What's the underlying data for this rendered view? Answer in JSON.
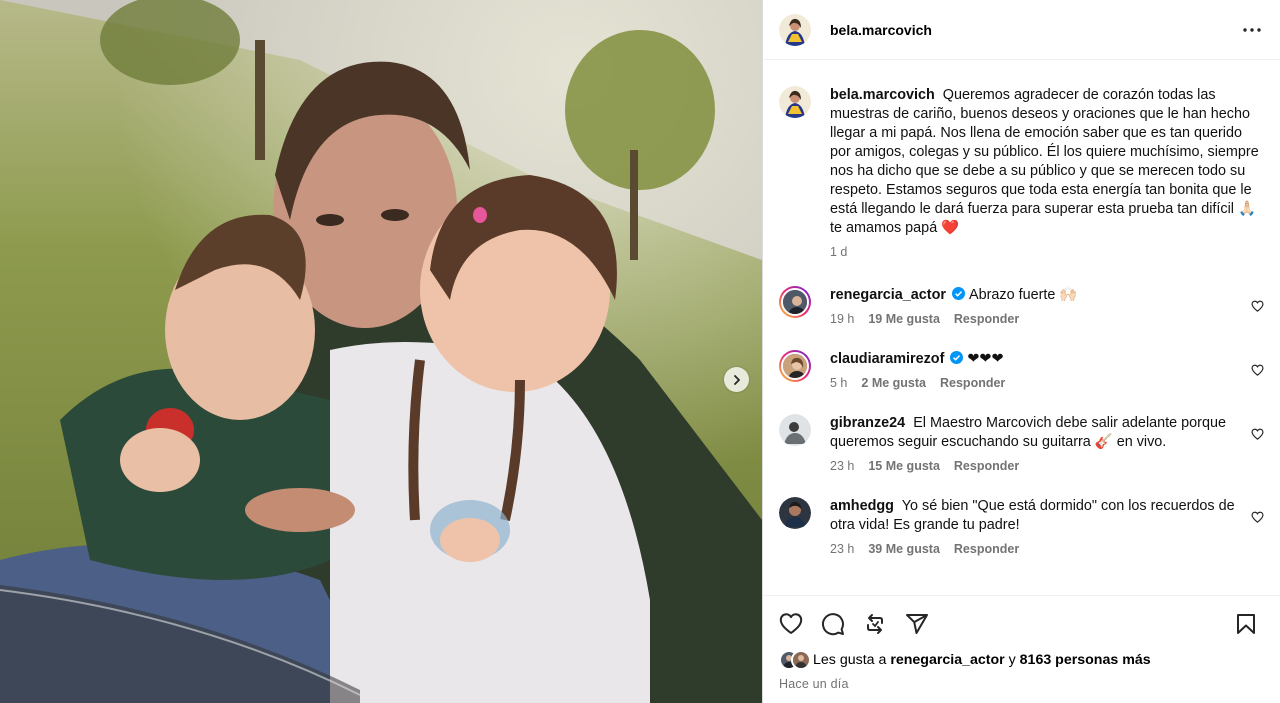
{
  "post": {
    "username": "bela.marcovich",
    "caption": "Queremos agradecer de corazón todas las muestras de cariño, buenos deseos y oraciones que le han hecho llegar a mi papá. Nos llena de emoción saber que es tan querido por amigos, colegas y su público. Él los quiere muchísimo, siempre nos ha dicho que se debe a su público y que se merecen todo su respeto. Estamos seguros que toda esta energía tan bonita que le está llegando le dará fuerza para superar esta prueba tan difícil 🙏🏻 te amamos papá ❤️",
    "caption_time": "1 d",
    "likes_prefix": "Les gusta a",
    "likes_user": "renegarcia_actor",
    "likes_joiner": "y",
    "likes_count": "8163 personas más",
    "posted_ago": "Hace un día"
  },
  "comments": [
    {
      "username": "renegarcia_actor",
      "verified": true,
      "text": "Abrazo fuerte 🙌🏻",
      "time": "19 h",
      "likes": "19 Me gusta",
      "reply": "Responder"
    },
    {
      "username": "claudiaramirezof",
      "verified": true,
      "text": "❤❤❤",
      "time": "5 h",
      "likes": "2 Me gusta",
      "reply": "Responder"
    },
    {
      "username": "gibranze24",
      "verified": false,
      "text": "El Maestro Marcovich debe salir adelante porque queremos seguir escuchando su guitarra 🎸 en vivo.",
      "time": "23 h",
      "likes": "15 Me gusta",
      "reply": "Responder"
    },
    {
      "username": "amhedgg",
      "verified": false,
      "text": "Yo sé bien \"Que está dormido\" con los recuerdos de otra vida! Es grande tu padre!",
      "time": "23 h",
      "likes": "39 Me gusta",
      "reply": "Responder"
    }
  ],
  "icons": {
    "more": "more-options-icon",
    "next": "chevron-right-icon",
    "like": "heart-icon",
    "comment": "comment-icon",
    "repost": "repost-icon",
    "share": "send-icon",
    "save": "bookmark-icon",
    "verified": "verified-badge-icon"
  },
  "colors": {
    "verified": "#0095f6",
    "border": "#dbdbdb",
    "muted": "#737373"
  }
}
